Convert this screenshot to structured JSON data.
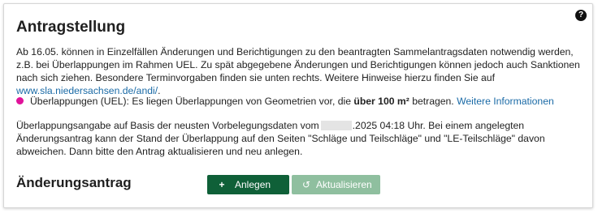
{
  "panel": {
    "title": "Antragstellung",
    "help_icon": "question-circle-icon",
    "intro_text": "Ab 16.05. können in Einzelfällen Änderungen und Berichtigungen zu den beantragten Sammelantragsdaten notwendig werden, z.B. bei Überlappungen im Rahmen UEL. Zu spät abgegebene Änderungen und Berichtigungen können jedoch auch Sanktionen nach sich ziehen. Besondere Terminvorgaben finden sie unten rechts. Weitere Hinweise hierzu finden Sie auf",
    "intro_link": "www.sla.niedersachsen.de/andi/",
    "intro_end": ".",
    "overlap": {
      "bullet_color": "#e0129a",
      "text_before": "Überlappungen (UEL): Es liegen Überlappungen von Geometrien vor, die",
      "text_bold": "über 100 m²",
      "text_after": "betragen.",
      "link": "Weitere Informationen"
    },
    "basis_text_before": "Überlappungsangabe auf Basis der neusten Vorbelegungsdaten vom",
    "basis_text_after": ".2025 04:18 Uhr. Bei einem angelegten Änderungsantrag kann der Stand der Überlappung auf den Seiten \"Schläge und Teilschläge\" und \"LE-Teilschläge\" davon abweichen. Dann bitte den Antrag aktualisieren und neu anlegen."
  },
  "change_request": {
    "label": "Änderungsantrag",
    "add_button": {
      "icon": "plus-icon",
      "glyph": "+",
      "label": "Anlegen",
      "color": "#0f6038"
    },
    "refresh_button": {
      "icon": "refresh-icon",
      "glyph": "↺",
      "label": "Aktualisieren",
      "color": "#8fbf9f"
    }
  }
}
